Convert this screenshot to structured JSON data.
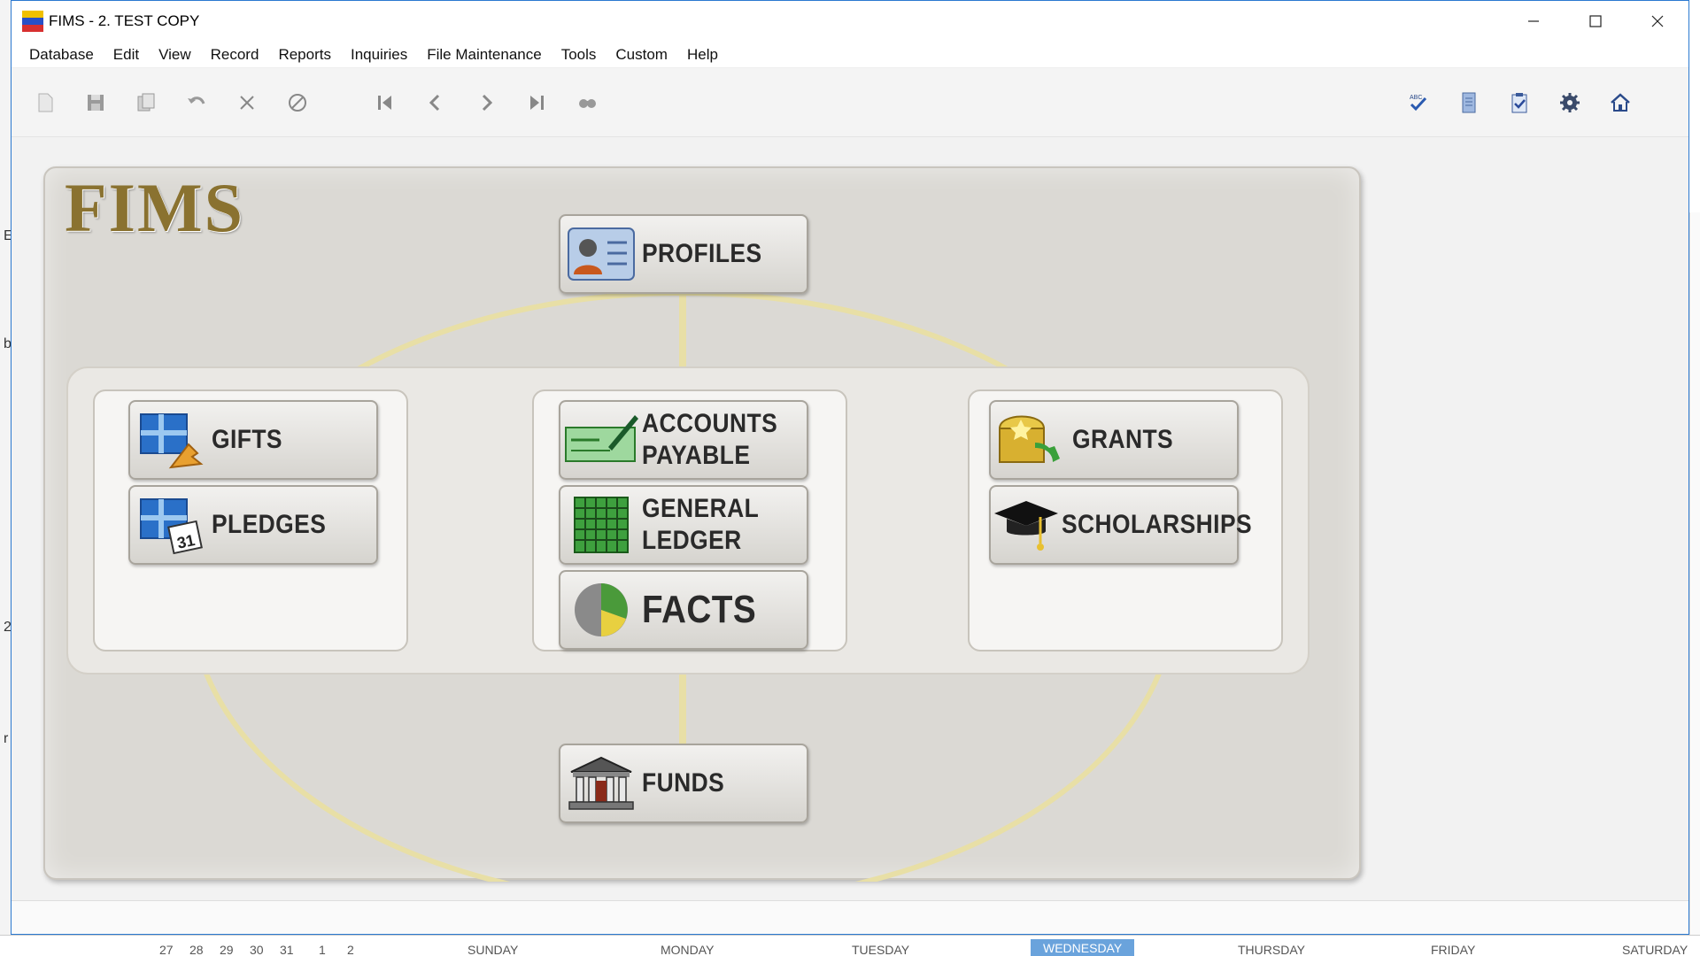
{
  "window": {
    "title": "FIMS - 2. TEST COPY",
    "controls": {
      "minimize": "—",
      "maximize": "☐",
      "close": "✕"
    }
  },
  "menu": [
    "Database",
    "Edit",
    "View",
    "Record",
    "Reports",
    "Inquiries",
    "File Maintenance",
    "Tools",
    "Custom",
    "Help"
  ],
  "toolbar_left": [
    "new-record-icon",
    "save-icon",
    "copy-icon",
    "undo-icon",
    "delete-icon",
    "cancel-icon",
    "first-record-icon",
    "previous-record-icon",
    "next-record-icon",
    "last-record-icon",
    "find-icon"
  ],
  "toolbar_right": [
    "spell-check-icon",
    "notes-icon",
    "task-checklist-icon",
    "settings-gear-icon",
    "home-icon"
  ],
  "panel": {
    "logo": "FIMS",
    "profiles": "PROFILES",
    "gifts": "GIFTS",
    "pledges": "PLEDGES",
    "accounts_payable": [
      "ACCOUNTS",
      "PAYABLE"
    ],
    "general_ledger": [
      "GENERAL",
      "LEDGER"
    ],
    "facts": "FACTS",
    "grants": "GRANTS",
    "scholarships": "SCHOLARSHIPS",
    "funds": "FUNDS"
  },
  "calendar_strip": {
    "days": [
      "SUNDAY",
      "MONDAY",
      "TUESDAY",
      "WEDNESDAY",
      "THURSDAY",
      "FRIDAY",
      "SATURDAY"
    ],
    "active_day": "WEDNESDAY",
    "dates": [
      "27",
      "28",
      "29",
      "30",
      "31",
      "1",
      "2"
    ]
  },
  "colors": {
    "accent": "#2b79d0",
    "logo": "#8a7230",
    "ellipse": "#e8dfa6"
  }
}
